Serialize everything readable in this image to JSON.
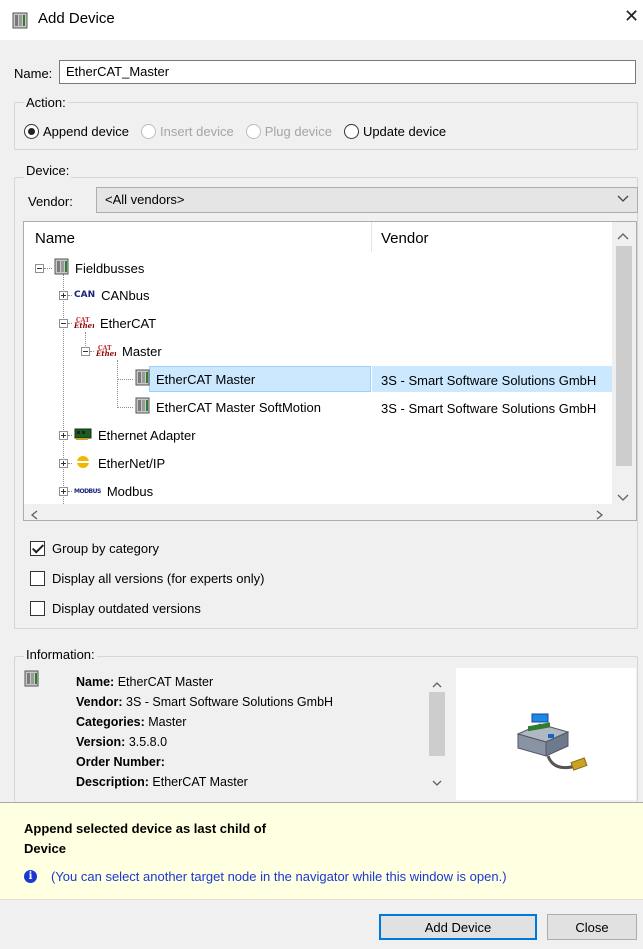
{
  "window": {
    "title": "Add Device",
    "close_glyph": "✕"
  },
  "name_field": {
    "label": "Name:",
    "value": "EtherCAT_Master"
  },
  "action": {
    "group_label": "Action:",
    "options": [
      {
        "label": "Append device",
        "checked": true,
        "enabled": true
      },
      {
        "label": "Insert device",
        "checked": false,
        "enabled": false
      },
      {
        "label": "Plug device",
        "checked": false,
        "enabled": false
      },
      {
        "label": "Update device",
        "checked": false,
        "enabled": true
      }
    ]
  },
  "device": {
    "group_label": "Device:",
    "vendor_label": "Vendor:",
    "vendor_value": "<All vendors>",
    "columns": {
      "name": "Name",
      "vendor": "Vendor"
    },
    "tree": [
      {
        "label": "Fieldbusses",
        "vendor": ""
      },
      {
        "label": "CANbus",
        "vendor": ""
      },
      {
        "label": "EtherCAT",
        "vendor": ""
      },
      {
        "label": "Master",
        "vendor": ""
      },
      {
        "label": "EtherCAT Master",
        "vendor": "3S - Smart Software Solutions GmbH"
      },
      {
        "label": "EtherCAT Master SoftMotion",
        "vendor": "3S - Smart Software Solutions GmbH"
      },
      {
        "label": "Ethernet Adapter",
        "vendor": ""
      },
      {
        "label": "EtherNet/IP",
        "vendor": ""
      },
      {
        "label": "Modbus",
        "vendor": ""
      }
    ],
    "icon_text": {
      "can": "CAN",
      "ethercat": "EtherCAT",
      "modbus": "MODBUS"
    }
  },
  "options": [
    {
      "label": "Group by category",
      "checked": true
    },
    {
      "label": "Display all versions (for experts only)",
      "checked": false
    },
    {
      "label": "Display outdated versions",
      "checked": false
    }
  ],
  "information": {
    "group_label": "Information:",
    "rows": [
      {
        "key": "Name:",
        "value": "EtherCAT Master"
      },
      {
        "key": "Vendor:",
        "value": "3S - Smart Software Solutions GmbH"
      },
      {
        "key": "Categories:",
        "value": "Master"
      },
      {
        "key": "Version:",
        "value": "3.5.8.0"
      },
      {
        "key": "Order Number:",
        "value": ""
      },
      {
        "key": "Description:",
        "value": "EtherCAT Master"
      }
    ]
  },
  "hint": {
    "title_line1": "Append selected device as last child of",
    "title_line2": "Device",
    "info": "(You can select another target node in the navigator while this window is open.)"
  },
  "buttons": {
    "add": "Add Device",
    "close": "Close"
  }
}
